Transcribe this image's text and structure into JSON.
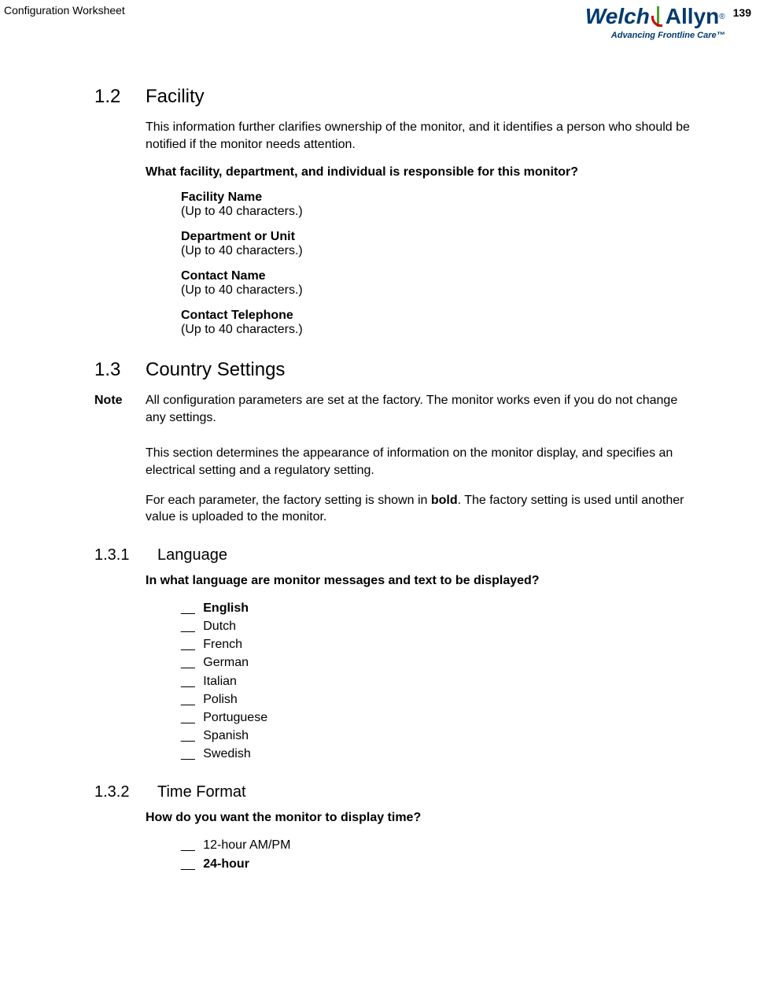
{
  "header": {
    "title": "Configuration Worksheet",
    "page": "139",
    "logo_welch": "Welch",
    "logo_allyn": "Allyn",
    "logo_reg": "®",
    "tagline": "Advancing Frontline Care™"
  },
  "s12": {
    "num": "1.2",
    "title": "Facility",
    "intro": "This information further clarifies ownership of the monitor, and it identifies a person who should be notified if the monitor needs attention.",
    "question": "What facility, department, and individual is responsible for this monitor?",
    "fields": [
      {
        "label": "Facility Name",
        "hint": "(Up to 40 characters.)"
      },
      {
        "label": "Department or Unit",
        "hint": "(Up to 40 characters.)"
      },
      {
        "label": "Contact Name",
        "hint": "(Up to 40 characters.)"
      },
      {
        "label": "Contact Telephone",
        "hint": "(Up to 40 characters.)"
      }
    ]
  },
  "s13": {
    "num": "1.3",
    "title": "Country Settings",
    "note_label": "Note",
    "note_text": "All configuration parameters are set at the factory. The monitor works even if you do not change any settings.",
    "para1": "This section determines the appearance of information on the monitor display, and specifies an electrical setting and a regulatory setting.",
    "para2_pre": "For each parameter, the factory setting is shown in ",
    "para2_bold": "bold",
    "para2_post": ". The factory setting is used until another value is uploaded to the monitor."
  },
  "s131": {
    "num": "1.3.1",
    "title": "Language",
    "question": "In what language are monitor messages and text to be displayed?",
    "options": [
      {
        "label": "English",
        "default": true
      },
      {
        "label": "Dutch",
        "default": false
      },
      {
        "label": "French",
        "default": false
      },
      {
        "label": "German",
        "default": false
      },
      {
        "label": "Italian",
        "default": false
      },
      {
        "label": "Polish",
        "default": false
      },
      {
        "label": "Portuguese",
        "default": false
      },
      {
        "label": "Spanish",
        "default": false
      },
      {
        "label": "Swedish",
        "default": false
      }
    ]
  },
  "s132": {
    "num": "1.3.2",
    "title": "Time Format",
    "question": "How do you want the monitor to display time?",
    "options": [
      {
        "label": "12-hour AM/PM",
        "default": false
      },
      {
        "label": "24-hour",
        "default": true
      }
    ]
  },
  "blank_mark": "__"
}
